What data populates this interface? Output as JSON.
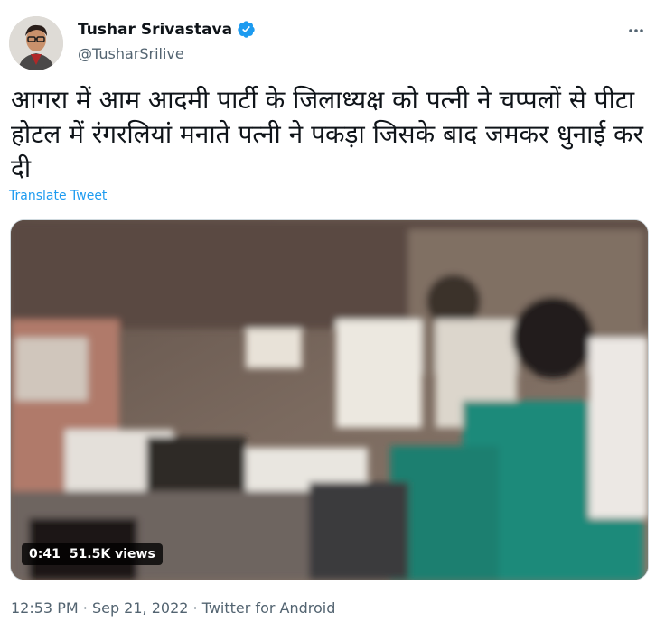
{
  "author": {
    "name": "Tushar Srivastava",
    "handle": "@TusharSrilive",
    "verified": true
  },
  "tweet": {
    "text": "आगरा में आम आदमी पार्टी के जिलाध्यक्ष को पत्नी ने चप्पलों से पीटा होटल में रंगरलियां मनाते पत्नी ने पकड़ा जिसके बाद जमकर धुनाई कर दी",
    "translate_label": "Translate Tweet"
  },
  "video": {
    "duration": "0:41",
    "views": "51.5K views"
  },
  "meta": {
    "time": "12:53 PM",
    "separator": "·",
    "date": "Sep 21, 2022",
    "source": "Twitter for Android"
  },
  "colors": {
    "link": "#1d9bf0",
    "verified": "#1d9bf0",
    "secondary_text": "#536471",
    "primary_text": "#0f1419"
  },
  "icons": {
    "verified": "verified-badge-icon",
    "more": "more-dots-icon"
  }
}
